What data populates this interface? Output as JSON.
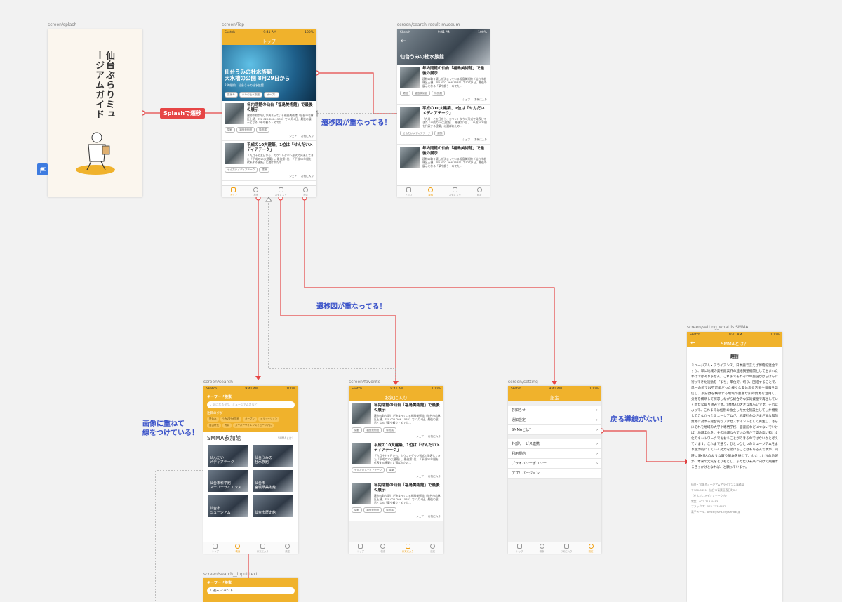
{
  "labels": {
    "splash": "screen/splash",
    "top": "screen/Top",
    "museum": "screen/search-result-museum",
    "search": "screen/search",
    "favorite": "screen/favorite",
    "setting": "screen/setting",
    "what_is": "screen/setting_what is SMMA",
    "input": "screen/search__input text"
  },
  "status": {
    "carrier": "Sketch",
    "time": "9:41 AM",
    "battery": "100%"
  },
  "splash": {
    "title": "仙台ぶらりミュージアムガイド"
  },
  "top": {
    "nav_title": "トップ",
    "hero_title": "仙台うみの杜水族館\n大水槽の公開 8月29日から",
    "hero_sub": "2 時間前　仙台うみの杜水族館",
    "hero_tags": [
      "夏休み",
      "うみの杜水族館",
      "オープン"
    ]
  },
  "articles": [
    {
      "title": "年内閉館の仙台「福島美術館」で最後の展示",
      "body": "建物の取り壊しが決まっている福島美術館（仙台市若林区土樋、TEL 022-266-1535）で12月4日、最後の展示となる「華や鶴う・めでた…",
      "tags": [
        "閉館",
        "福島美術館",
        "特別展"
      ],
      "share": "シェア",
      "fav": "お気に入り"
    },
    {
      "title": "平成の10大建築、1位は「せんだいメディアテーク」",
      "body": "「九月十と五日から、カウントダウン形式で発表してきた『平成の10大建築』。最後第1位、「平成30年間を代表する建築」に選ばれたの…",
      "tags": [
        "せんだいメディアテーク",
        "建築"
      ],
      "share": "シェア",
      "fav": "お気に入り"
    }
  ],
  "museum": {
    "nav_title": "仙台うみの杜水族館"
  },
  "search": {
    "keyword_label": "キーワード検索",
    "placeholder": "気になるタグ、ミュージアム名など",
    "tag_label": "注目のタグ",
    "tags": [
      "夏休み",
      "うみの杜水族館",
      "オープン",
      "イリュージョン",
      "自由研究",
      "写真",
      "スーパーサイエンスミュージアム"
    ],
    "section": "SMMA参加館",
    "more": "SMMAとは？",
    "tiles": [
      "せんだい\nメディアテーク",
      "仙台うみの\n杜水族館",
      "仙台市科学館\nスーパーサイエンス",
      "仙台市\n宮城県美術館",
      "仙台市\nミュージアム",
      "仙台市歴史館"
    ]
  },
  "favorite": {
    "nav_title": "お気に入り"
  },
  "setting": {
    "nav_title": "設定",
    "rows": [
      "お知らせ",
      "通知設定",
      "SMMAとは？",
      "外部サービス連携",
      "利用規約",
      "プライバシーポリシー",
      "アプリバージョン"
    ]
  },
  "what": {
    "nav_title": "SMMAとは？",
    "heading": "趣旨",
    "body": "ミュージアム・アライアンス。日本語で言えば博物館連合ですが、単に地域の美術館業界の連絡調整機関として生まれたわけではありません。これまでそれぞれの施設がばらばらに行ってきた活動を「まち」単位で、切り、団結することで、単一の館では不可能だった様々な実体ある活動や情報を発信し、多分野を横断する地域の豊富な知的資源を活用し、分野を横断して探求しながら総合的な知的資産で再生していく新たな取り組みです。SMMAの大きなねらいです。それによって、これまでは個別の独立した文化施設としてしか機能してこなかったミュージアムが、地域社会のさまざまな知的資源に対する総合的なアクセスポイントとして再生し、さらにそれを地域の大学や専門学校、図書館などにつないでいけば、地域全体を、その地域ならではの豊かで質の高い知と文化のネットワークでおおうことができるのではないかと考えています。これまで通り、ひとつひとつのミュージアムをより魅力的にしていく努力を続けることはもちろんですが、同時にSMMAのような取り組みを通じて、わたしたちの地域が、本来の元気をとりもどし、ふたたび未来に向けて飛躍するきっかけとなれば、と願っています。",
    "contact": [
      "仙台・宮城ミュージアムアライアンス事務局",
      "〒980-0821　仙台市青葉区春日町2-1",
      "（せんだいメディアテーク内）",
      "電話：022-713-4483",
      "ファックス：022-713-4482",
      "電子メール：office@smt.city.sendai.jp"
    ]
  },
  "input": {
    "keyword_label": "キーワード検索",
    "value": "週末 イベント"
  },
  "tabs": [
    "トップ",
    "検索",
    "お気に入り",
    "設定"
  ],
  "annotations": {
    "splash_transition": "Splashで遷移",
    "overlap_1": "遷移図が重なってる！",
    "overlap_2": "遷移図が重なってる！",
    "image_overlay": "画像に重ねて\n線をつけている！",
    "no_back": "戻る導線がない！"
  },
  "colors": {
    "accent": "#f0b22c",
    "annotation": "#3b53c9",
    "arrow": "#e64545"
  }
}
